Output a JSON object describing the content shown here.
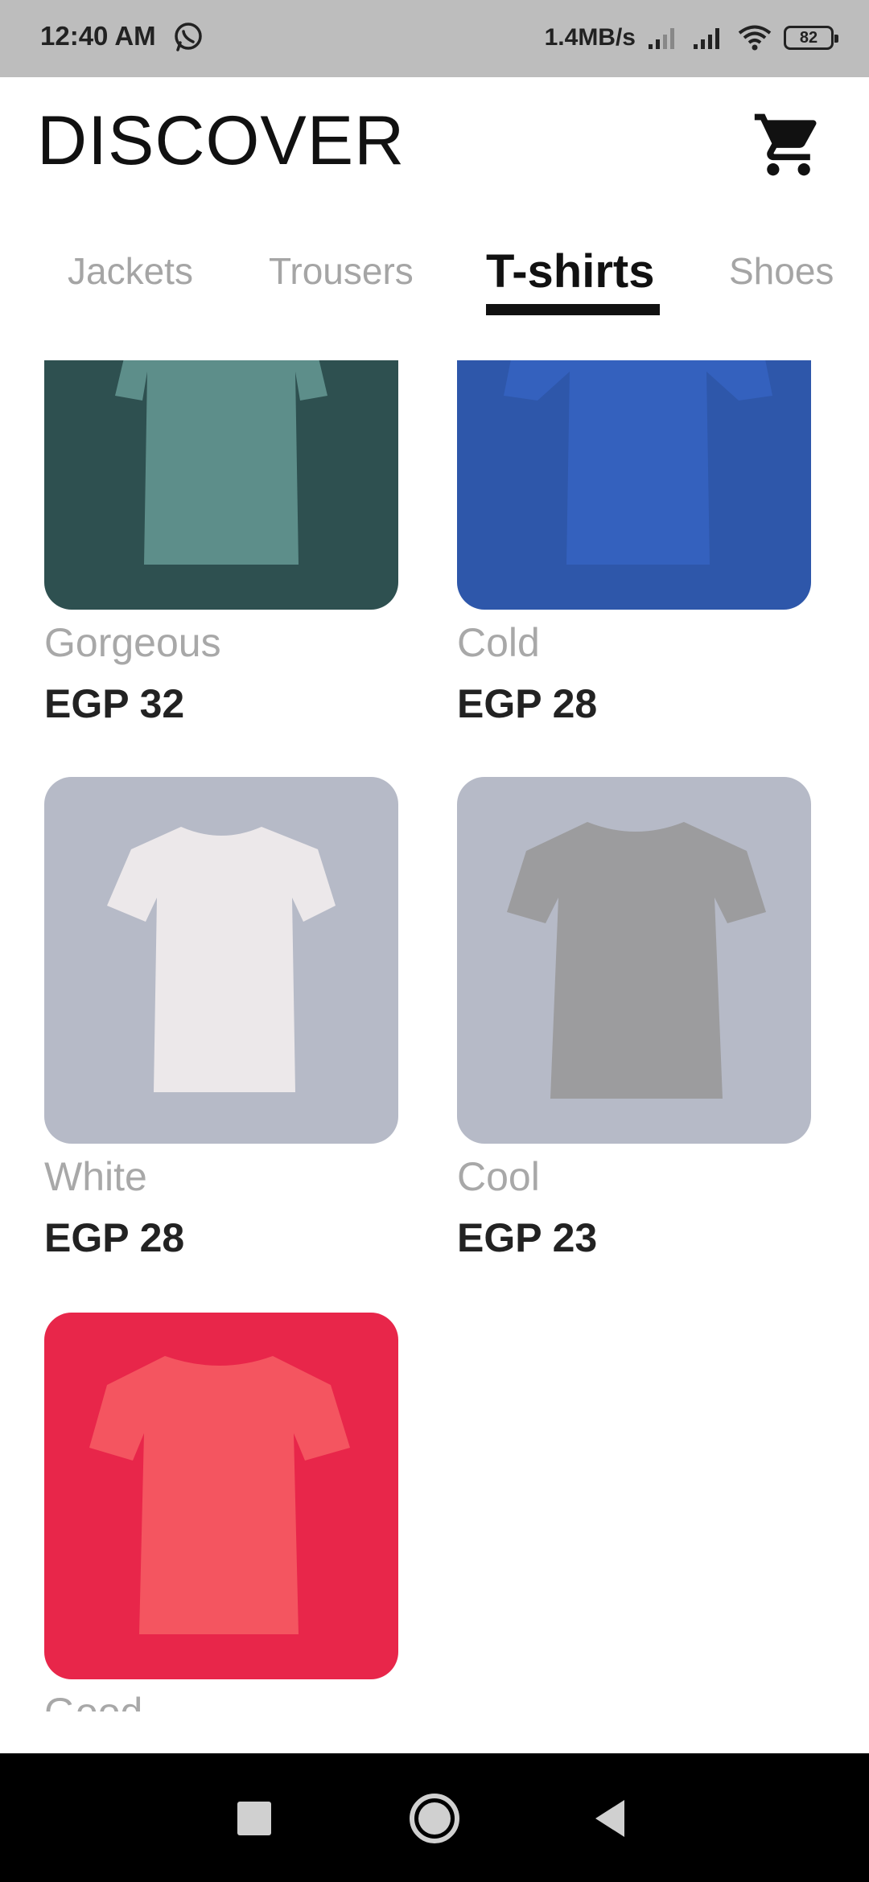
{
  "status": {
    "time": "12:40 AM",
    "speed": "1.4MB/s",
    "battery": "82",
    "icons": [
      "whatsapp-icon",
      "signal-weak-icon",
      "signal-icon",
      "wifi-icon",
      "battery-icon"
    ]
  },
  "header": {
    "title": "DISCOVER",
    "cart_icon": "shopping-cart-icon"
  },
  "tabs": [
    {
      "label": "Jackets",
      "active": false
    },
    {
      "label": "Trousers",
      "active": false
    },
    {
      "label": "T-shirts",
      "active": true
    },
    {
      "label": "Shoes",
      "active": false
    }
  ],
  "products": [
    {
      "name": "Gorgeous",
      "price": "EGP 32",
      "bg": "#2e5050",
      "shirt": "#5d8e8a"
    },
    {
      "name": "Cold",
      "price": "EGP 28",
      "bg": "#2e57aa",
      "shirt": "#3461be"
    },
    {
      "name": "White",
      "price": "EGP 28",
      "bg": "#b6bac7",
      "shirt": "#ece8ea"
    },
    {
      "name": "Cool",
      "price": "EGP 23",
      "bg": "#b6bac7",
      "shirt": "#9c9c9e"
    },
    {
      "name": "Good",
      "price": "",
      "bg": "#e8264a",
      "shirt": "#f45560"
    }
  ],
  "colors": {
    "accent": "#111111",
    "muted_text": "#a8a8a8",
    "status_bar": "#bdbdbd",
    "nav_bar": "#000000"
  },
  "navbar": {
    "icons": [
      "recents-square-icon",
      "home-circle-icon",
      "back-triangle-icon"
    ]
  }
}
